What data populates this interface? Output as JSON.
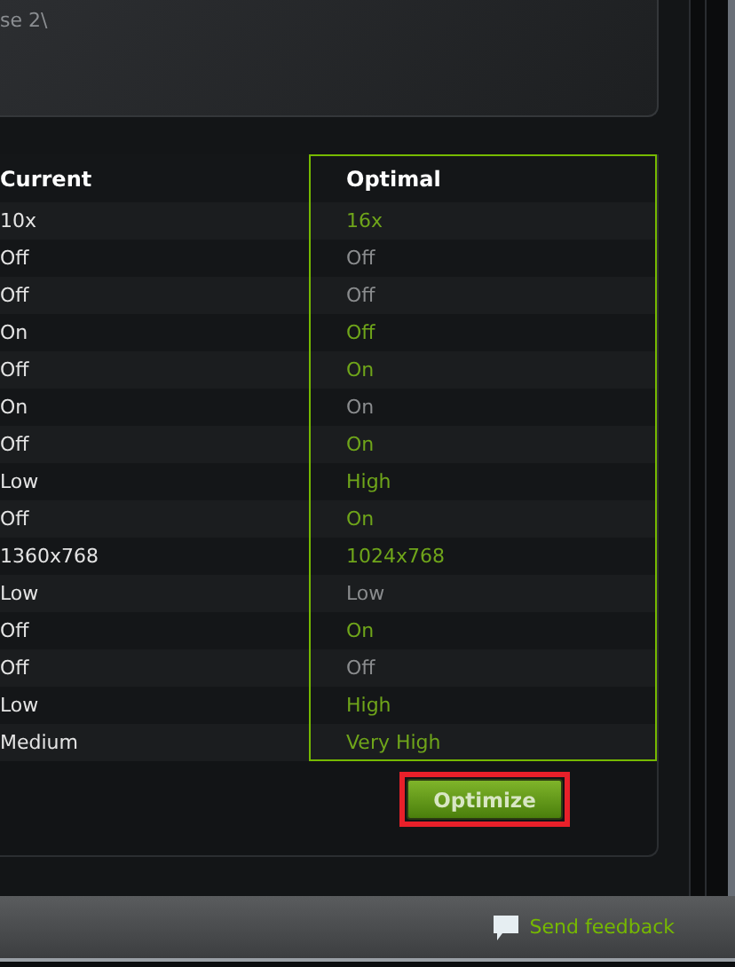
{
  "top_panel": {
    "path_text": "se 2\\"
  },
  "table": {
    "columns": [
      "Current",
      "Optimal"
    ],
    "rows": [
      {
        "current": "10x",
        "optimal": "16x",
        "changed": true
      },
      {
        "current": "Off",
        "optimal": "Off",
        "changed": false
      },
      {
        "current": "Off",
        "optimal": "Off",
        "changed": false
      },
      {
        "current": "On",
        "optimal": "Off",
        "changed": true
      },
      {
        "current": "Off",
        "optimal": "On",
        "changed": true
      },
      {
        "current": "On",
        "optimal": "On",
        "changed": false
      },
      {
        "current": "Off",
        "optimal": "On",
        "changed": true
      },
      {
        "current": "Low",
        "optimal": "High",
        "changed": true
      },
      {
        "current": "Off",
        "optimal": "On",
        "changed": true
      },
      {
        "current": "1360x768",
        "optimal": "1024x768",
        "changed": true
      },
      {
        "current": "Low",
        "optimal": "Low",
        "changed": false
      },
      {
        "current": "Off",
        "optimal": "On",
        "changed": true
      },
      {
        "current": "Off",
        "optimal": "Off",
        "changed": false
      },
      {
        "current": "Low",
        "optimal": "High",
        "changed": true
      },
      {
        "current": "Medium",
        "optimal": "Very High",
        "changed": true
      }
    ]
  },
  "optimize_button": {
    "label": "Optimize",
    "highlighted": true
  },
  "footer": {
    "feedback_link": "Send feedback"
  }
}
